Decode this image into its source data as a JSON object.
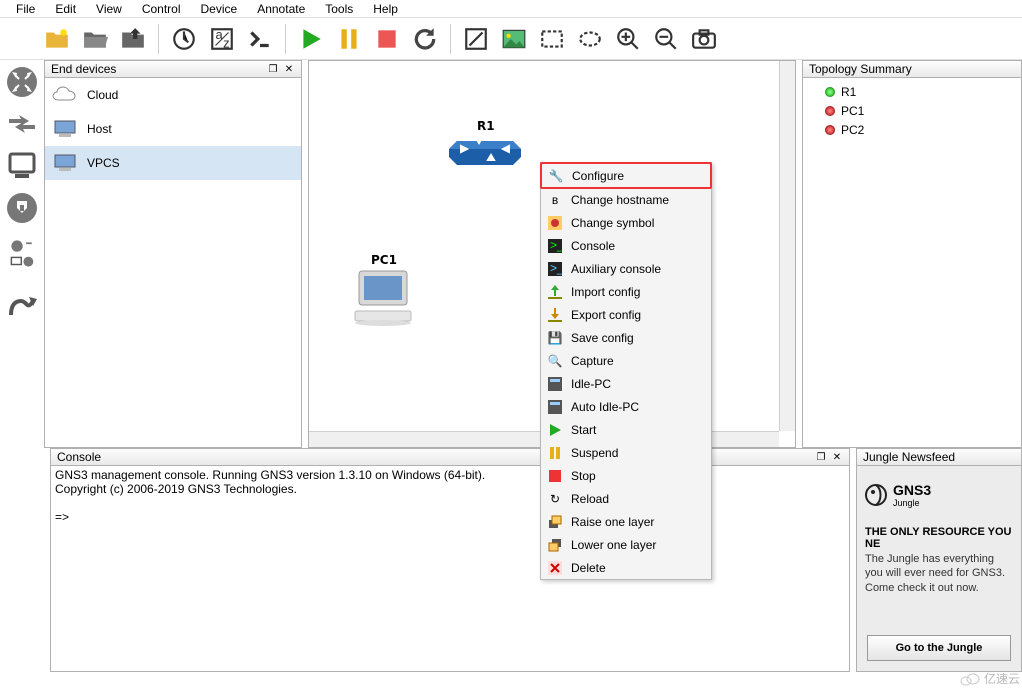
{
  "menu": [
    "File",
    "Edit",
    "View",
    "Control",
    "Device",
    "Annotate",
    "Tools",
    "Help"
  ],
  "panels": {
    "devices_title": "End devices",
    "topo_title": "Topology Summary",
    "console_title": "Console",
    "jungle_title": "Jungle Newsfeed"
  },
  "devices": [
    {
      "name": "Cloud"
    },
    {
      "name": "Host"
    },
    {
      "name": "VPCS"
    }
  ],
  "canvas": {
    "r1_label": "R1",
    "pc1_label": "PC1"
  },
  "topo": [
    {
      "name": "R1",
      "status": "green"
    },
    {
      "name": "PC1",
      "status": "red"
    },
    {
      "name": "PC2",
      "status": "red"
    }
  ],
  "console": {
    "line1": "GNS3 management console. Running GNS3 version 1.3.10 on Windows (64-bit).",
    "line2": "Copyright (c) 2006-2019 GNS3 Technologies.",
    "prompt": "=>"
  },
  "jungle": {
    "brand1": "GNS3",
    "brand2": "Jungle",
    "headline": "THE ONLY RESOURCE YOU NE",
    "body": "The Jungle has everything you will ever need for GNS3. Come check it out now.",
    "button": "Go to the Jungle"
  },
  "context_menu": [
    "Configure",
    "Change hostname",
    "Change symbol",
    "Console",
    "Auxiliary console",
    "Import config",
    "Export config",
    "Save config",
    "Capture",
    "Idle-PC",
    "Auto Idle-PC",
    "Start",
    "Suspend",
    "Stop",
    "Reload",
    "Raise one layer",
    "Lower one layer",
    "Delete"
  ],
  "watermark": "亿速云"
}
